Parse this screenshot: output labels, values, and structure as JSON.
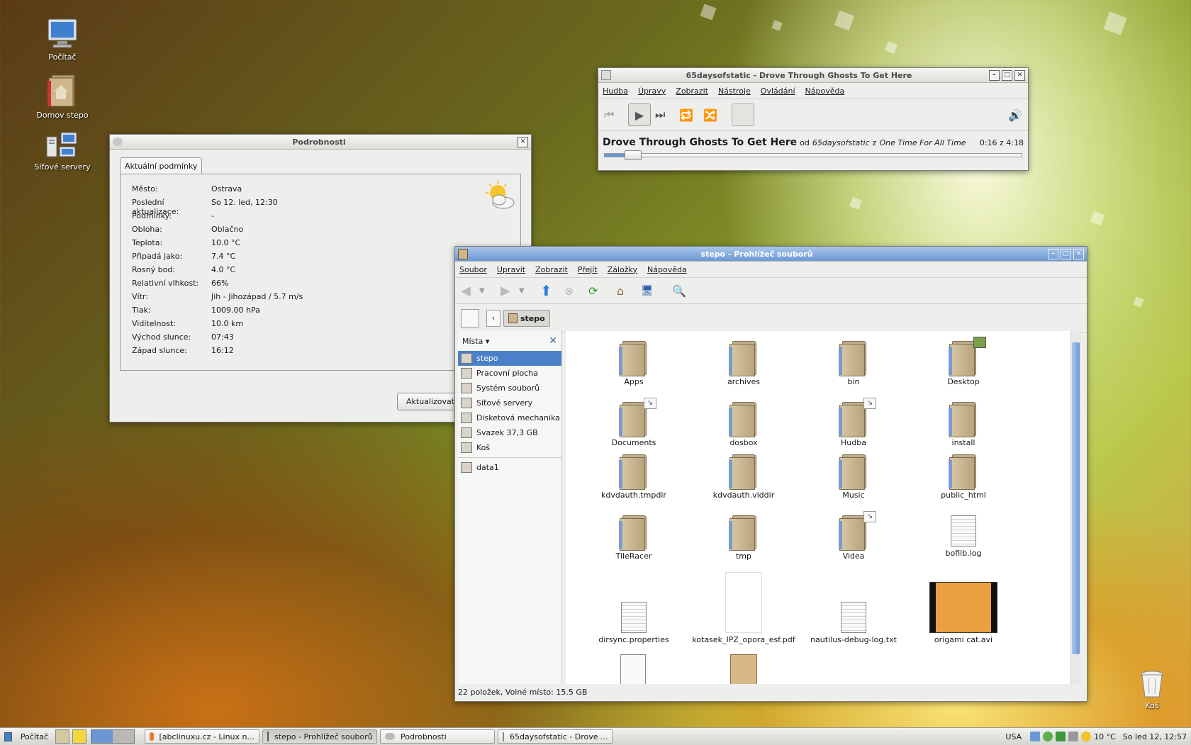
{
  "desktop": {
    "icons": [
      {
        "label": "Počítač"
      },
      {
        "label": "Domov stepo"
      },
      {
        "label": "Síťové servery"
      }
    ],
    "trash_label": "Koš"
  },
  "weather": {
    "title": "Podrobnosti",
    "tab": "Aktuální podmínky",
    "rows": [
      {
        "k": "Město:",
        "v": "Ostrava"
      },
      {
        "k": "Poslední aktualizace:",
        "v": "So 12. led, 12:30"
      },
      {
        "k": "Podmínky:",
        "v": "-"
      },
      {
        "k": "Obloha:",
        "v": "Oblačno"
      },
      {
        "k": "Teplota:",
        "v": "10.0 °C"
      },
      {
        "k": "Připadá jako:",
        "v": "7.4 °C"
      },
      {
        "k": "Rosný bod:",
        "v": "4.0 °C"
      },
      {
        "k": "Relativní vlhkost:",
        "v": "66%"
      },
      {
        "k": "Vítr:",
        "v": "Jih - Jihozápad / 5.7 m/s"
      },
      {
        "k": "Tlak:",
        "v": "1009.00 hPa"
      },
      {
        "k": "Viditelnost:",
        "v": "10.0 km"
      },
      {
        "k": "Východ slunce:",
        "v": "07:43"
      },
      {
        "k": "Západ slunce:",
        "v": "16:12"
      }
    ],
    "update_button": "Aktualizovat"
  },
  "player": {
    "title": "65daysofstatic - Drove Through Ghosts To Get Here",
    "menu": [
      "Hudba",
      "Úpravy",
      "Zobrazit",
      "Nástroje",
      "Ovládání",
      "Nápověda"
    ],
    "track": "Drove Through Ghosts To Get Here",
    "by": "od",
    "artist": "65daysofstatic",
    "from": "z",
    "album": "One Time For All Time",
    "time": "0:16 z 4:18",
    "progress": 0.062
  },
  "fm": {
    "title": "stepo - Prohlížeč souborů",
    "menu": [
      "Soubor",
      "Upravit",
      "Zobrazit",
      "Přejít",
      "Záložky",
      "Nápověda"
    ],
    "location": "stepo",
    "sidebar_title": "Místa",
    "places": [
      "stepo",
      "Pracovní plocha",
      "Systém souborů",
      "Síťové servery",
      "Disketová mechanika",
      "Svazek 37,3 GB",
      "Koš"
    ],
    "bookmarks": [
      "data1"
    ],
    "items": [
      {
        "name": "Apps",
        "kind": "folder"
      },
      {
        "name": "archives",
        "kind": "folder"
      },
      {
        "name": "bin",
        "kind": "folder"
      },
      {
        "name": "Desktop",
        "kind": "folder"
      },
      {
        "name": "Documents",
        "kind": "link"
      },
      {
        "name": "dosbox",
        "kind": "folder"
      },
      {
        "name": "Hudba",
        "kind": "link"
      },
      {
        "name": "install",
        "kind": "folder"
      },
      {
        "name": "kdvdauth.tmpdir",
        "kind": "folder"
      },
      {
        "name": "kdvdauth.viddir",
        "kind": "folder"
      },
      {
        "name": "Music",
        "kind": "folder"
      },
      {
        "name": "public_html",
        "kind": "folder"
      },
      {
        "name": "TileRacer",
        "kind": "folder"
      },
      {
        "name": "tmp",
        "kind": "folder"
      },
      {
        "name": "Videa",
        "kind": "link"
      },
      {
        "name": "bofilb.log",
        "kind": "doc"
      },
      {
        "name": "dirsync.properties",
        "kind": "doc"
      },
      {
        "name": "kotasek_IPZ_opora_esf.pdf",
        "kind": "pdf"
      },
      {
        "name": "nautilus-debug-log.txt",
        "kind": "doc"
      },
      {
        "name": "origami cat.avi",
        "kind": "video"
      }
    ],
    "status": "22 položek, Volné místo: 15.5 GB"
  },
  "taskbar": {
    "menu": "Počítač",
    "tasks": [
      "[abclinuxu.cz - Linux n...",
      "stepo - Prohlížeč souborů",
      "Podrobnosti",
      "65daysofstatic - Drove ..."
    ],
    "keyboard": "USA",
    "temp": "10 °C",
    "clock": "So led 12, 12:57"
  }
}
